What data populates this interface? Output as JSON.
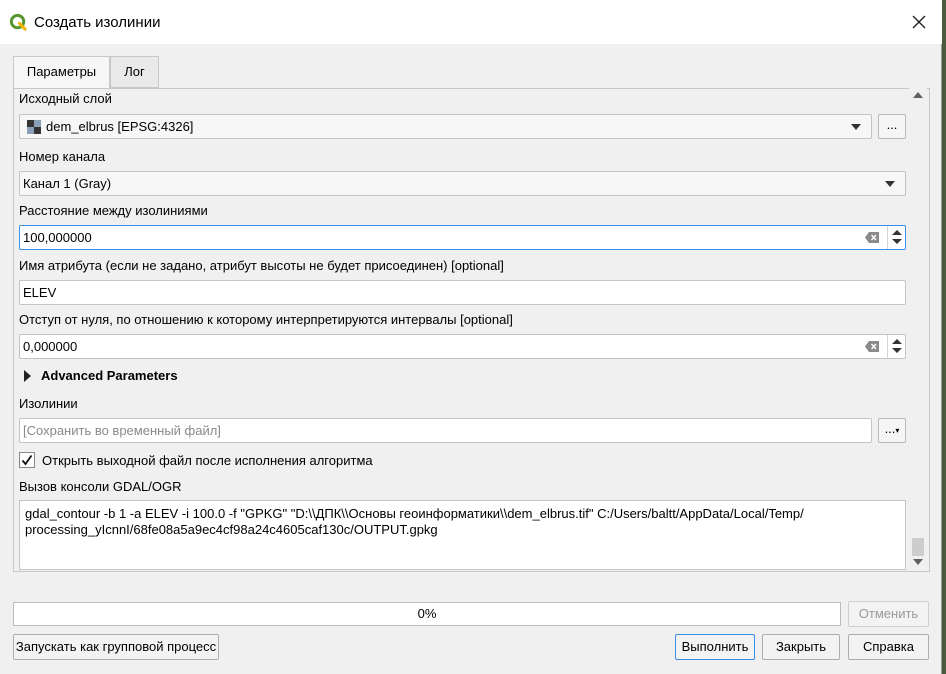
{
  "window": {
    "title": "Создать изолинии"
  },
  "tabs": [
    {
      "label": "Параметры",
      "active": true
    },
    {
      "label": "Лог",
      "active": false
    }
  ],
  "params": {
    "input_layer_label": "Исходный слой",
    "input_layer_value": "dem_elbrus [EPSG:4326]",
    "band_label": "Номер канала",
    "band_value": "Канал 1 (Gray)",
    "interval_label": "Расстояние между изолиниями",
    "interval_value": "100,000000",
    "attr_label": "Имя атрибута (если не задано, атрибут высоты не будет присоединен) [optional]",
    "attr_value": "ELEV",
    "offset_label": "Отступ от нуля, по отношению к которому интерпретируются интервалы [optional]",
    "offset_value": "0,000000",
    "advanced_label": "Advanced Parameters",
    "output_label": "Изолинии",
    "output_placeholder": "[Сохранить во временный файл]",
    "open_output_label": "Открыть выходной файл после исполнения алгоритма",
    "open_output_checked": true,
    "console_label": "Вызов консоли GDAL/OGR",
    "console_line1": "gdal_contour -b 1 -a ELEV -i 100.0 -f \"GPKG\" \"D:\\\\ДПК\\\\Основы геоинформатики\\\\dem_elbrus.tif\" C:/Users/baltt/AppData/Local/Temp/",
    "console_line2": "processing_yIcnnI/68fe08a5a9ec4cf98a24c4605caf130c/OUTPUT.gpkg",
    "browse_label": "..."
  },
  "progress": {
    "text": "0%",
    "value": 0
  },
  "buttons": {
    "cancel": "Отменить",
    "batch": "Запускать как групповой процесс",
    "run": "Выполнить",
    "close": "Закрыть",
    "help": "Справка"
  },
  "icons": {
    "app": "qgis-logo-icon",
    "close": "close-icon",
    "layer": "raster-layer-icon",
    "clear": "clear-icon"
  },
  "colors": {
    "accent": "#3a8ee6",
    "qgis_green": "#589632"
  }
}
